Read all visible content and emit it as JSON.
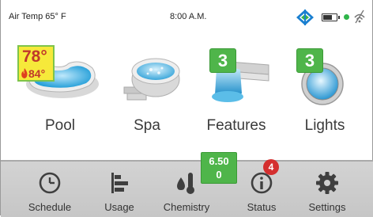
{
  "status": {
    "air_temp": "Air Temp 65° F",
    "time": "8:00 A.M."
  },
  "tiles": [
    {
      "label": "Pool",
      "set_temp": "78°",
      "current_temp": "84°"
    },
    {
      "label": "Spa"
    },
    {
      "label": "Features",
      "count": "3"
    },
    {
      "label": "Lights",
      "count": "3"
    }
  ],
  "nav": [
    {
      "label": "Schedule",
      "icon": "clock-icon"
    },
    {
      "label": "Usage",
      "icon": "usage-bars-icon"
    },
    {
      "label": "Chemistry",
      "icon": "chemistry-icon",
      "badge_top": "6.50",
      "badge_bottom": "0"
    },
    {
      "label": "Status",
      "icon": "info-icon",
      "alerts": "4"
    },
    {
      "label": "Settings",
      "icon": "gear-icon"
    }
  ],
  "colors": {
    "accent_green": "#4fb54a",
    "alert_red": "#d42f2f",
    "temp_badge_yellow": "#f6e93a"
  }
}
